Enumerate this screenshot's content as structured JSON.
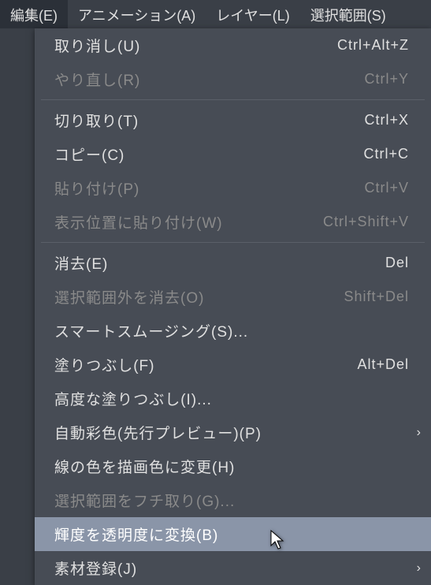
{
  "menubar": {
    "items": [
      {
        "label": "編集(E)",
        "active": true
      },
      {
        "label": "アニメーション(A)",
        "active": false
      },
      {
        "label": "レイヤー(L)",
        "active": false
      },
      {
        "label": "選択範囲(S)",
        "active": false
      }
    ]
  },
  "dropdown": {
    "items": [
      {
        "type": "item",
        "label": "取り消し(U)",
        "shortcut": "Ctrl+Alt+Z",
        "disabled": false
      },
      {
        "type": "item",
        "label": "やり直し(R)",
        "shortcut": "Ctrl+Y",
        "disabled": true
      },
      {
        "type": "separator"
      },
      {
        "type": "item",
        "label": "切り取り(T)",
        "shortcut": "Ctrl+X",
        "disabled": false
      },
      {
        "type": "item",
        "label": "コピー(C)",
        "shortcut": "Ctrl+C",
        "disabled": false
      },
      {
        "type": "item",
        "label": "貼り付け(P)",
        "shortcut": "Ctrl+V",
        "disabled": true
      },
      {
        "type": "item",
        "label": "表示位置に貼り付け(W)",
        "shortcut": "Ctrl+Shift+V",
        "disabled": true
      },
      {
        "type": "separator"
      },
      {
        "type": "item",
        "label": "消去(E)",
        "shortcut": "Del",
        "disabled": false
      },
      {
        "type": "item",
        "label": "選択範囲外を消去(O)",
        "shortcut": "Shift+Del",
        "disabled": true
      },
      {
        "type": "item",
        "label": "スマートスムージング(S)...",
        "shortcut": "",
        "disabled": false
      },
      {
        "type": "item",
        "label": "塗りつぶし(F)",
        "shortcut": "Alt+Del",
        "disabled": false
      },
      {
        "type": "item",
        "label": "高度な塗りつぶし(I)...",
        "shortcut": "",
        "disabled": false
      },
      {
        "type": "item",
        "label": "自動彩色(先行プレビュー)(P)",
        "shortcut": "",
        "submenu": true,
        "disabled": false
      },
      {
        "type": "item",
        "label": "線の色を描画色に変更(H)",
        "shortcut": "",
        "disabled": false
      },
      {
        "type": "item",
        "label": "選択範囲をフチ取り(G)...",
        "shortcut": "",
        "disabled": true
      },
      {
        "type": "item",
        "label": "輝度を透明度に変換(B)",
        "shortcut": "",
        "highlighted": true,
        "disabled": false
      },
      {
        "type": "item",
        "label": "素材登録(J)",
        "shortcut": "",
        "submenu": true,
        "disabled": false
      }
    ]
  }
}
